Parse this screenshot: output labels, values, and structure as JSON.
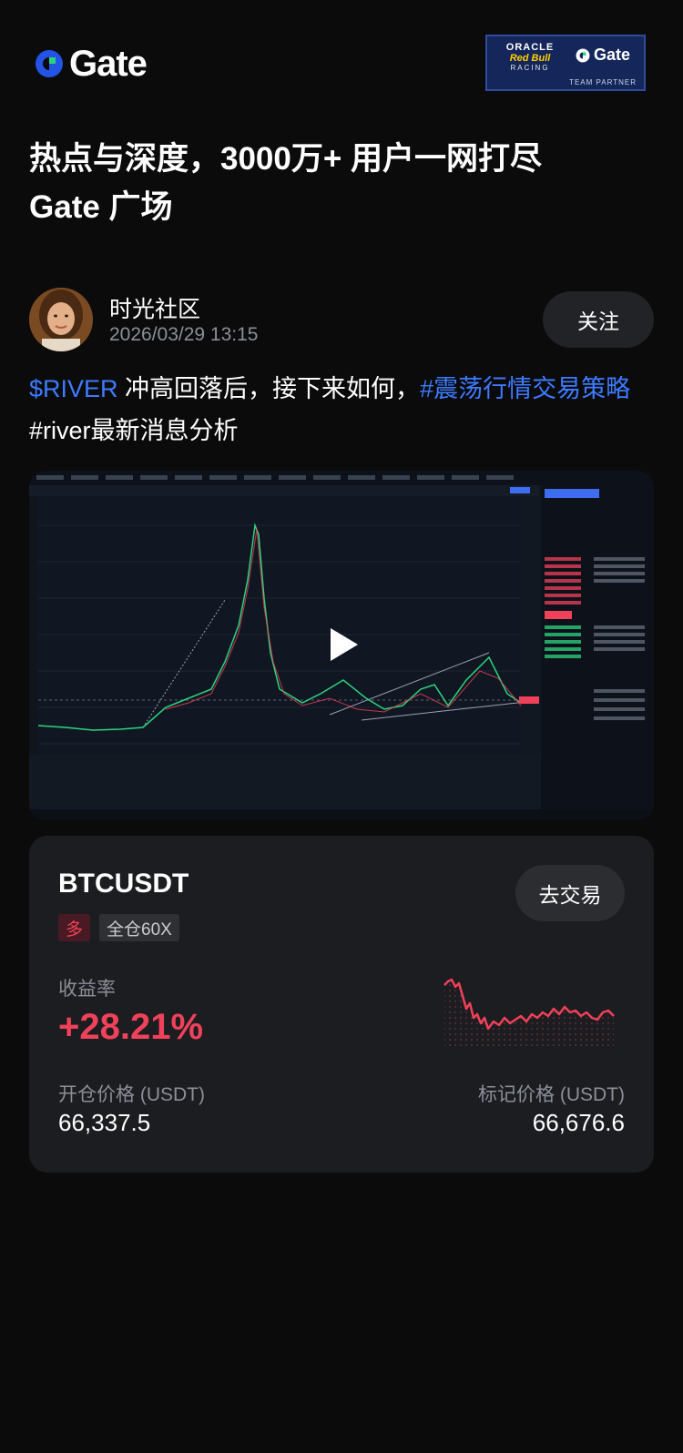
{
  "header": {
    "logo_text": "Gate",
    "partner": {
      "oracle": "ORACLE",
      "redbull": "Red Bull",
      "racing": "RACING",
      "gate": "Gate",
      "tag": "TEAM PARTNER"
    }
  },
  "headline": {
    "line1": "热点与深度，3000万+ 用户一网打尽",
    "line2": "Gate 广场"
  },
  "author": {
    "name": "时光社区",
    "time": "2026/03/29 13:15",
    "follow_label": "关注"
  },
  "post": {
    "ticker": "$RIVER",
    "text1": " 冲高回落后，接下来如何，",
    "hashtag1": "#震荡行情交易策略",
    "text2": " #river最新消息分析"
  },
  "video": {
    "icon": "play-icon"
  },
  "position_card": {
    "pair": "BTCUSDT",
    "trade_label": "去交易",
    "side": "多",
    "mode": "全仓60X",
    "roi_label": "收益率",
    "roi_value": "+28.21%",
    "open_label": "开仓价格 (USDT)",
    "open_value": "66,337.5",
    "mark_label": "标记价格 (USDT)",
    "mark_value": "66,676.6",
    "accent": "#f0415a"
  },
  "colors": {
    "brand_blue": "#2354e6",
    "tag_blue": "#3d7bff",
    "brand_green": "#2bd47f",
    "negative_red": "#f0415a"
  }
}
